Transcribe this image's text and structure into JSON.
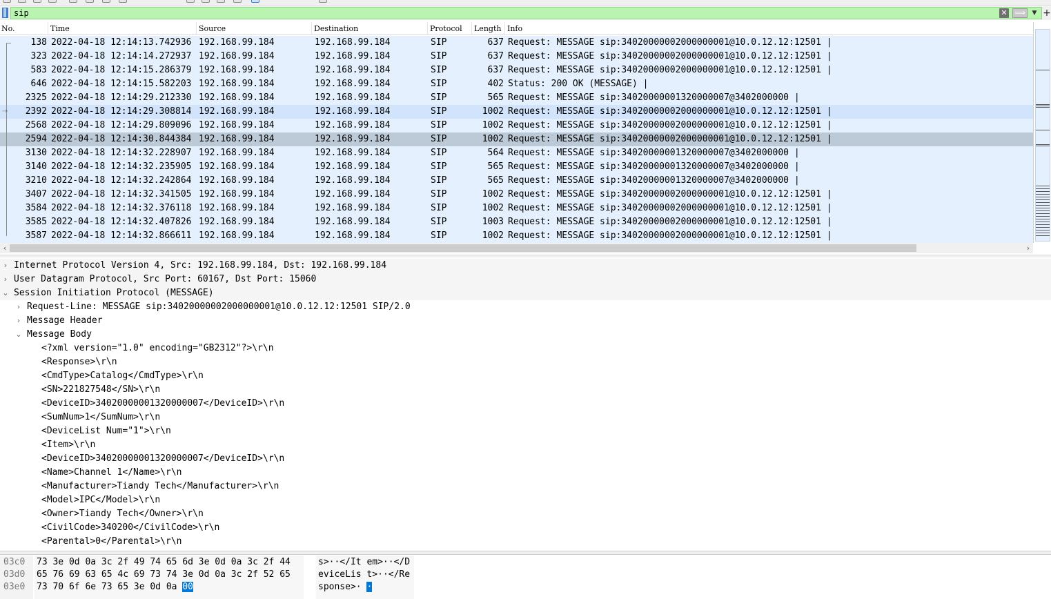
{
  "filter": {
    "value": "sip",
    "clear_icon": "close-icon",
    "apply_icon": "arrow-right-icon",
    "dropdown_icon": "chevron-down-icon",
    "add_icon": "plus-icon",
    "accent": "#b9f5b0"
  },
  "packet_list": {
    "columns": [
      "No.",
      "Time",
      "Source",
      "Destination",
      "Protocol",
      "Length",
      "Info"
    ],
    "rows": [
      {
        "no": "138",
        "time": "2022-04-18 12:14:13.742936",
        "src": "192.168.99.184",
        "dst": "192.168.99.184",
        "proto": "SIP",
        "len": "637",
        "info": "Request: MESSAGE sip:34020000002000000001@10.0.12.12:12501 |"
      },
      {
        "no": "323",
        "time": "2022-04-18 12:14:14.272937",
        "src": "192.168.99.184",
        "dst": "192.168.99.184",
        "proto": "SIP",
        "len": "637",
        "info": "Request: MESSAGE sip:34020000002000000001@10.0.12.12:12501 |"
      },
      {
        "no": "583",
        "time": "2022-04-18 12:14:15.286379",
        "src": "192.168.99.184",
        "dst": "192.168.99.184",
        "proto": "SIP",
        "len": "637",
        "info": "Request: MESSAGE sip:34020000002000000001@10.0.12.12:12501 |"
      },
      {
        "no": "646",
        "time": "2022-04-18 12:14:15.582203",
        "src": "192.168.99.184",
        "dst": "192.168.99.184",
        "proto": "SIP",
        "len": "402",
        "info": "Status: 200 OK (MESSAGE)  |"
      },
      {
        "no": "2325",
        "time": "2022-04-18 12:14:29.212330",
        "src": "192.168.99.184",
        "dst": "192.168.99.184",
        "proto": "SIP",
        "len": "565",
        "info": "Request: MESSAGE sip:34020000001320000007@3402000000  |"
      },
      {
        "no": "2392",
        "time": "2022-04-18 12:14:29.308814",
        "src": "192.168.99.184",
        "dst": "192.168.99.184",
        "proto": "SIP",
        "len": "1002",
        "info": "Request: MESSAGE sip:34020000002000000001@10.0.12.12:12501 |"
      },
      {
        "no": "2568",
        "time": "2022-04-18 12:14:29.809096",
        "src": "192.168.99.184",
        "dst": "192.168.99.184",
        "proto": "SIP",
        "len": "1002",
        "info": "Request: MESSAGE sip:34020000002000000001@10.0.12.12:12501 |"
      },
      {
        "no": "2594",
        "time": "2022-04-18 12:14:30.844384",
        "src": "192.168.99.184",
        "dst": "192.168.99.184",
        "proto": "SIP",
        "len": "1002",
        "info": "Request: MESSAGE sip:34020000002000000001@10.0.12.12:12501 |"
      },
      {
        "no": "3130",
        "time": "2022-04-18 12:14:32.228907",
        "src": "192.168.99.184",
        "dst": "192.168.99.184",
        "proto": "SIP",
        "len": "564",
        "info": "Request: MESSAGE sip:34020000001320000007@3402000000  |"
      },
      {
        "no": "3140",
        "time": "2022-04-18 12:14:32.235905",
        "src": "192.168.99.184",
        "dst": "192.168.99.184",
        "proto": "SIP",
        "len": "565",
        "info": "Request: MESSAGE sip:34020000001320000007@3402000000  |"
      },
      {
        "no": "3210",
        "time": "2022-04-18 12:14:32.242864",
        "src": "192.168.99.184",
        "dst": "192.168.99.184",
        "proto": "SIP",
        "len": "565",
        "info": "Request: MESSAGE sip:34020000001320000007@3402000000  |"
      },
      {
        "no": "3407",
        "time": "2022-04-18 12:14:32.341505",
        "src": "192.168.99.184",
        "dst": "192.168.99.184",
        "proto": "SIP",
        "len": "1002",
        "info": "Request: MESSAGE sip:34020000002000000001@10.0.12.12:12501 |"
      },
      {
        "no": "3584",
        "time": "2022-04-18 12:14:32.376118",
        "src": "192.168.99.184",
        "dst": "192.168.99.184",
        "proto": "SIP",
        "len": "1002",
        "info": "Request: MESSAGE sip:34020000002000000001@10.0.12.12:12501 |"
      },
      {
        "no": "3585",
        "time": "2022-04-18 12:14:32.407826",
        "src": "192.168.99.184",
        "dst": "192.168.99.184",
        "proto": "SIP",
        "len": "1003",
        "info": "Request: MESSAGE sip:34020000002000000001@10.0.12.12:12501 |"
      },
      {
        "no": "3587",
        "time": "2022-04-18 12:14:32.866611",
        "src": "192.168.99.184",
        "dst": "192.168.99.184",
        "proto": "SIP",
        "len": "1002",
        "info": "Request: MESSAGE sip:34020000002000000001@10.0.12.12:12501 |"
      }
    ],
    "selected_no": "2594",
    "hover_no": "2392",
    "row_color": "#e4f0fd",
    "selected_color": "#bccad7"
  },
  "details": {
    "rows": [
      {
        "level": 0,
        "toggle": "›",
        "text": "Internet Protocol Version 4, Src: 192.168.99.184, Dst: 192.168.99.184",
        "shaded": true
      },
      {
        "level": 0,
        "toggle": "›",
        "text": "User Datagram Protocol, Src Port: 60167, Dst Port: 15060",
        "shaded": true
      },
      {
        "level": 0,
        "toggle": "⌄",
        "text": "Session Initiation Protocol (MESSAGE)",
        "shaded": true
      },
      {
        "level": 1,
        "toggle": "›",
        "text": "Request-Line: MESSAGE sip:34020000002000000001@10.0.12.12:12501 SIP/2.0"
      },
      {
        "level": 1,
        "toggle": "›",
        "text": "Message Header"
      },
      {
        "level": 1,
        "toggle": "⌄",
        "text": "Message Body"
      },
      {
        "level": 2,
        "text": "<?xml version=\"1.0\" encoding=\"GB2312\"?>\\r\\n"
      },
      {
        "level": 2,
        "text": "<Response>\\r\\n"
      },
      {
        "level": 2,
        "text": "<CmdType>Catalog</CmdType>\\r\\n"
      },
      {
        "level": 2,
        "text": "<SN>221827548</SN>\\r\\n"
      },
      {
        "level": 2,
        "text": "<DeviceID>34020000001320000007</DeviceID>\\r\\n"
      },
      {
        "level": 2,
        "text": "<SumNum>1</SumNum>\\r\\n"
      },
      {
        "level": 2,
        "text": "<DeviceList Num=\"1\">\\r\\n"
      },
      {
        "level": 2,
        "text": "<Item>\\r\\n"
      },
      {
        "level": 2,
        "text": "<DeviceID>34020000001320000007</DeviceID>\\r\\n"
      },
      {
        "level": 2,
        "text": "<Name>Channel 1</Name>\\r\\n"
      },
      {
        "level": 2,
        "text": "<Manufacturer>Tiandy Tech</Manufacturer>\\r\\n"
      },
      {
        "level": 2,
        "text": "<Model>IPC</Model>\\r\\n"
      },
      {
        "level": 2,
        "text": "<Owner>Tiandy Tech</Owner>\\r\\n"
      },
      {
        "level": 2,
        "text": "<CivilCode>340200</CivilCode>\\r\\n"
      },
      {
        "level": 2,
        "text": "<Parental>0</Parental>\\r\\n"
      }
    ]
  },
  "bytes": {
    "rows": [
      {
        "offset": "03c0",
        "hex": "73 3e 0d 0a 3c 2f 49 74  65 6d 3e 0d 0a 3c 2f 44",
        "ascii": "s>··</It em>··</D"
      },
      {
        "offset": "03d0",
        "hex": "65 76 69 63 65 4c 69 73  74 3e 0d 0a 3c 2f 52 65",
        "ascii": "eviceLis t>··</Re"
      },
      {
        "offset": "03e0",
        "hex": "73 70 6f 6e 73 65 3e 0d  0a ",
        "hex_hl": "00",
        "ascii": "sponse>· ",
        "ascii_hl": "·"
      }
    ],
    "highlight_color": "#0078d7"
  }
}
